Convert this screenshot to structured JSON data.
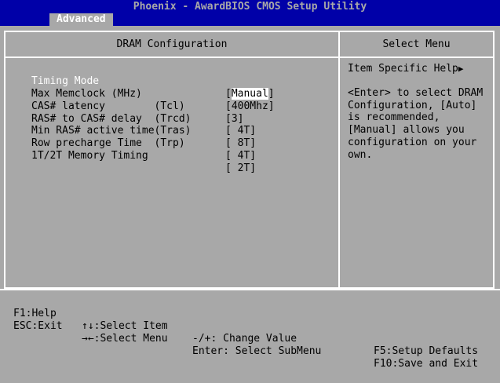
{
  "window": {
    "title": "Phoenix - AwardBIOS CMOS Setup Utility"
  },
  "tabs": [
    {
      "label": "Advanced"
    }
  ],
  "left_panel": {
    "title": "DRAM Configuration"
  },
  "right_panel": {
    "title": "Select Menu"
  },
  "settings": [
    {
      "label": "Timing Mode",
      "value": "Manual"
    },
    {
      "label": "Max Memclock (MHz)",
      "value": "[400Mhz]"
    },
    {
      "label": "CAS# latency        (Tcl)",
      "value": "[3]"
    },
    {
      "label": "RAS# to CAS# delay  (Trcd)",
      "value": "[ 4T]"
    },
    {
      "label": "Min RAS# active time(Tras)",
      "value": "[ 8T]"
    },
    {
      "label": "Row precharge Time  (Trp)",
      "value": "[ 4T]"
    },
    {
      "label": "1T/2T Memory Timing",
      "value": "[ 2T]"
    }
  ],
  "help": {
    "title": "Item Specific Help",
    "text": "<Enter> to select DRAM Configuration, [Auto] is recommended, [Manual] allows you configuration on your own."
  },
  "footer": {
    "f1_help": "F1:Help",
    "esc_exit": "ESC:Exit",
    "select_item": "↑↓:Select Item",
    "select_menu": "→←:Select Menu",
    "change_value": "-/+: Change Value",
    "select_submenu": "Enter: Select SubMenu",
    "setup_defaults": "F5:Setup Defaults",
    "save_exit": "F10:Save and Exit"
  },
  "colors": {
    "bar_blue": "#0000a8",
    "panel_gray": "#a8a8a8",
    "highlight": "#ffffff"
  },
  "icons": {
    "help_arrow": "right-triangle-icon"
  }
}
